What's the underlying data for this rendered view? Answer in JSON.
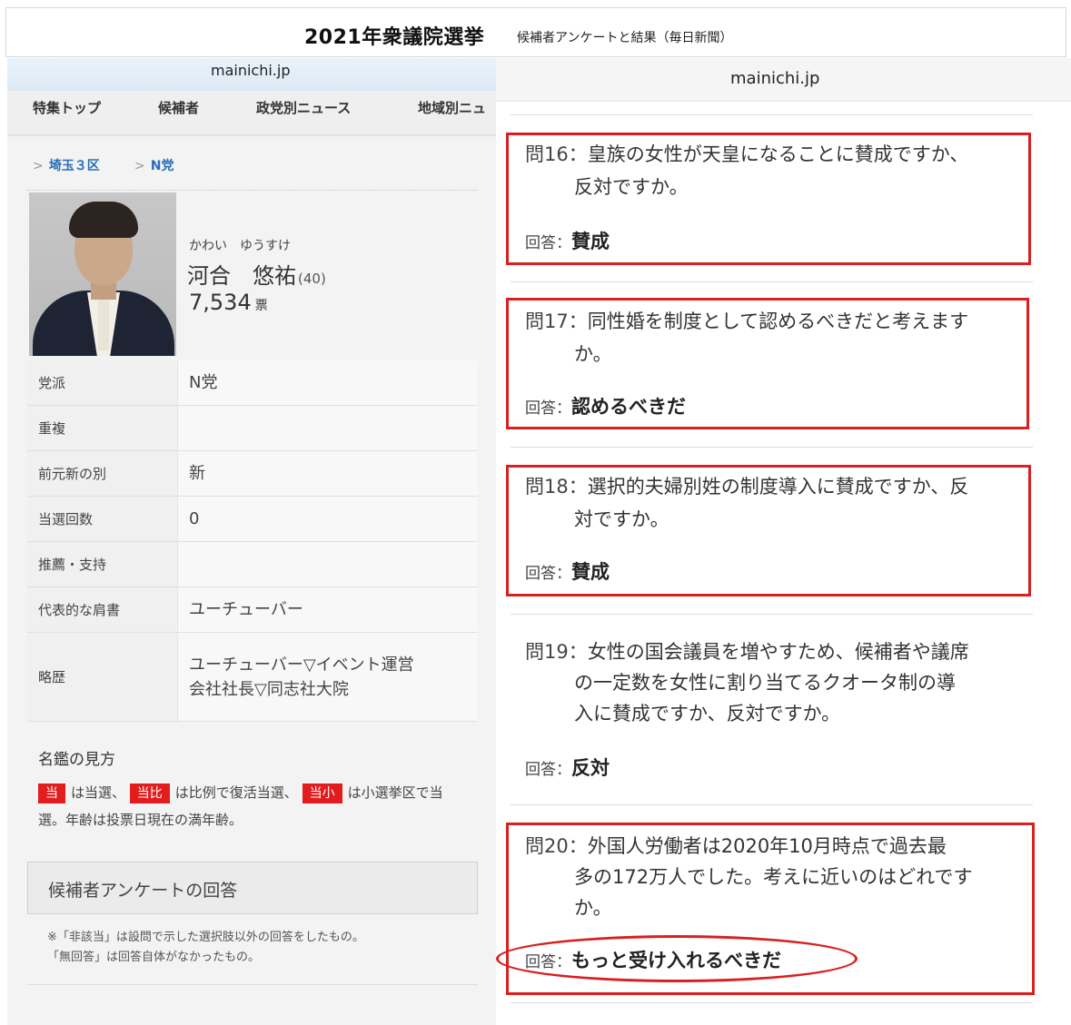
{
  "banner": {
    "title": "2021年衆議院選挙",
    "subtitle": "候補者アンケートと結果（毎日新聞）"
  },
  "left": {
    "domain": "mainichi.jp",
    "nav": [
      "特集トップ",
      "候補者",
      "政党別ニュース",
      "地域別ニュ"
    ],
    "breadcrumbs": [
      "埼玉３区",
      "N党"
    ],
    "candidate": {
      "kana": "かわい　ゆうすけ",
      "name": "河合　悠祐",
      "age": "(40)",
      "votes": "7,534",
      "votes_unit": "票"
    },
    "info": [
      {
        "label": "党派",
        "value": "N党"
      },
      {
        "label": "重複",
        "value": ""
      },
      {
        "label": "前元新の別",
        "value": "新"
      },
      {
        "label": "当選回数",
        "value": "0"
      },
      {
        "label": "推薦・支持",
        "value": ""
      },
      {
        "label": "代表的な肩書",
        "value": "ユーチューバー"
      },
      {
        "label": "略歴",
        "value": "ユーチューバー▽イベント運営\n会社社長▽同志社大院"
      }
    ],
    "legend": {
      "title": "名鑑の見方",
      "badge1": "当",
      "text1": "は当選、",
      "badge2": "当比",
      "text2": "は比例で復活当選、",
      "badge3": "当小",
      "text3": "は小選挙区で当選。年齢は投票日現在の満年齢。"
    },
    "survey": {
      "heading": "候補者アンケートの回答",
      "note1": "※「非該当」は設問で示した選択肢以外の回答をしたもの。",
      "note2": "「無回答」は回答自体がなかったもの。"
    }
  },
  "right": {
    "domain": "mainichi.jp",
    "answer_label": "回答：",
    "questions": [
      {
        "num": "問16：",
        "line1": "皇族の女性が天皇になることに賛成ですか、",
        "line2": "反対ですか。",
        "line3": "",
        "answer": "賛成"
      },
      {
        "num": "問17：",
        "line1": "同性婚を制度として認めるべきだと考えます",
        "line2": "か。",
        "line3": "",
        "answer": "認めるべきだ"
      },
      {
        "num": "問18：",
        "line1": "選択的夫婦別姓の制度導入に賛成ですか、反",
        "line2": "対ですか。",
        "line3": "",
        "answer": "賛成"
      },
      {
        "num": "問19：",
        "line1": "女性の国会議員を増やすため、候補者や議席",
        "line2": "の一定数を女性に割り当てるクオータ制の導",
        "line3": "入に賛成ですか、反対ですか。",
        "answer": "反対"
      },
      {
        "num": "問20：",
        "line1": "外国人労働者は2020年10月時点で過去最",
        "line2": "多の172万人でした。考えに近いのはどれです",
        "line3": "か。",
        "answer": "もっと受け入れるべきだ"
      }
    ]
  },
  "colors": {
    "highlight_red": "#d92020",
    "badge_red": "#e21d1d",
    "link_blue": "#2a6eb8"
  }
}
